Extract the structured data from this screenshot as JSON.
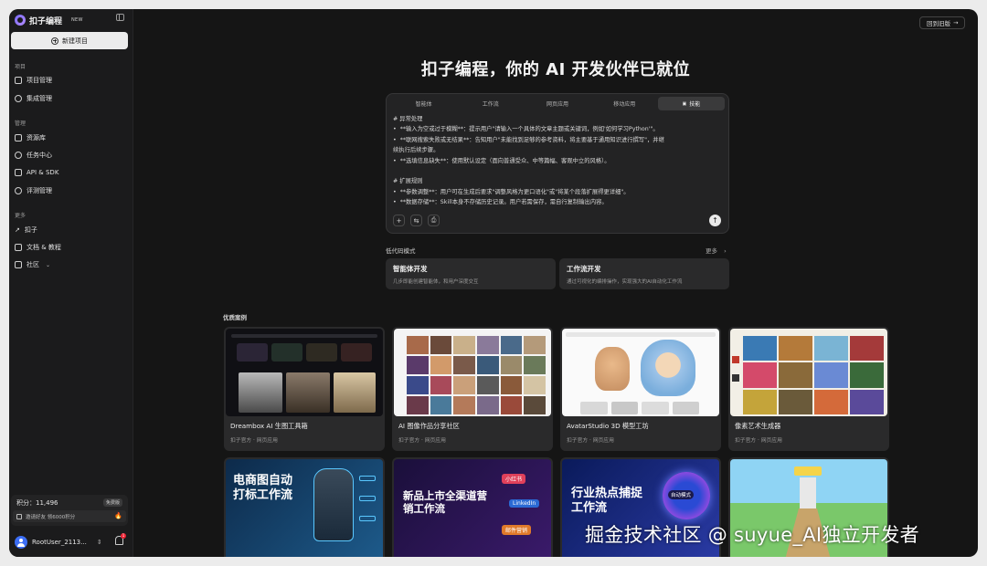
{
  "app": {
    "name": "扣子编程",
    "badge": "NEW",
    "back_to_old": "回到旧版"
  },
  "sidebar": {
    "new_project": "新建项目",
    "sections": [
      {
        "label": "项目",
        "items": [
          {
            "label": "项目管理",
            "icon": "folder-icon"
          },
          {
            "label": "集成管理",
            "icon": "plug-icon"
          }
        ]
      },
      {
        "label": "管理",
        "items": [
          {
            "label": "资源库",
            "icon": "library-icon"
          },
          {
            "label": "任务中心",
            "icon": "clock-icon"
          },
          {
            "label": "API & SDK",
            "icon": "code-icon"
          },
          {
            "label": "评测管理",
            "icon": "rocket-icon"
          }
        ]
      },
      {
        "label": "更多",
        "items": [
          {
            "label": "扣子",
            "icon": "arrow-up-right-icon"
          },
          {
            "label": "文档 & 教程",
            "icon": "book-icon"
          },
          {
            "label": "社区",
            "icon": "community-icon"
          }
        ]
      }
    ],
    "points": "积分：11,496",
    "free_badge": "免费版",
    "invite": "邀请好友 领6000积分",
    "user": "RootUser_2113...",
    "notifications": "1"
  },
  "main": {
    "headline": "扣子编程，你的 AI 开发伙伴已就位",
    "tabs": [
      {
        "label": "智能体",
        "active": false
      },
      {
        "label": "工作流",
        "active": false
      },
      {
        "label": "网页应用",
        "active": false
      },
      {
        "label": "移动应用",
        "active": false
      },
      {
        "label": "技能",
        "active": true
      }
    ],
    "composer_text": "# 异常处理\n•  **输入为空或过于模糊**：提示用户\"请输入一个具体的文章主题或关键词，例如'如何学习Python'\"。\n•  **联网搜索失败或无结果**：告知用户\"未能找到足够的参考资料，将主要基于通用知识进行撰写\"，并继\n续执行后续步骤。\n•  **选填信息缺失**：使用默认设定（面向普通受众、中等篇幅、客观中立的风格）。\n\n# 扩展规则\n•  **参数调整**：用户可在生成后要求\"调整风格为更口语化\"或\"将某个段落扩展得更详细\"。\n•  **数据存储**：Skill本身不存储历史记录。用户若需保存，需自行复制输出内容。",
    "low_code_label": "低代码模式",
    "more": "更多",
    "modes": [
      {
        "title": "智能体开发",
        "desc": "几步即能创建智能体，和用户深度交互"
      },
      {
        "title": "工作流开发",
        "desc": "通过可视化的编排操作，实现强大的AI自动化工作流"
      }
    ],
    "cases_label": "优质案例",
    "cases": [
      {
        "title": "Dreambox AI 生图工具箱",
        "meta": "扣子官方 · 网页应用"
      },
      {
        "title": "AI 图像作品分享社区",
        "meta": "扣子官方 · 网页应用"
      },
      {
        "title": "AvatarStudio 3D 模型工坊",
        "meta": "扣子官方 · 网页应用"
      },
      {
        "title": "像素艺术生成器",
        "meta": "扣子官方 · 网页应用"
      }
    ],
    "promos": [
      {
        "title": "电商图自动打标工作流"
      },
      {
        "title": "新品上市全渠道营销工作流",
        "tag1": "小红书",
        "tag2": "LinkedIn",
        "tag3": "邮件营销"
      },
      {
        "title": "行业热点捕捉工作流",
        "tag1": "自动模式"
      },
      {
        "title": ""
      }
    ]
  },
  "watermark": "掘金技术社区 @ suyue_AI独立开发者"
}
